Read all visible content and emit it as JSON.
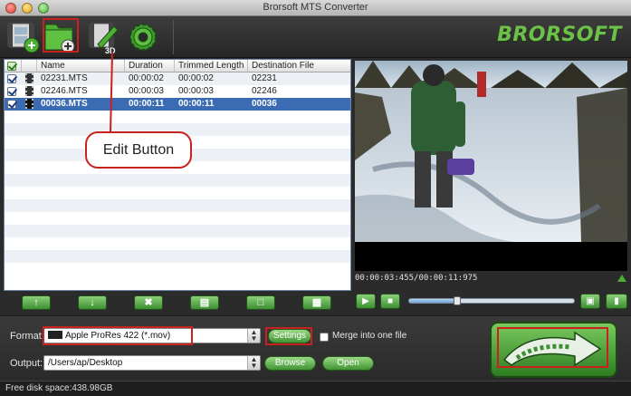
{
  "window": {
    "title": "Brorsoft MTS Converter"
  },
  "toolbar": {
    "logo_text": "BRORSOFT",
    "buttons": [
      "add-video",
      "edit",
      "3d-edit",
      "settings"
    ]
  },
  "file_list": {
    "columns": {
      "name": "Name",
      "duration": "Duration",
      "trimmed": "Trimmed Length",
      "destination": "Destination File"
    },
    "rows": [
      {
        "name": "02231.MTS",
        "duration": "00:00:02",
        "trimmed": "00:00:02",
        "destination": "02231",
        "checked": true,
        "selected": false
      },
      {
        "name": "02246.MTS",
        "duration": "00:00:03",
        "trimmed": "00:00:03",
        "destination": "02246",
        "checked": true,
        "selected": false
      },
      {
        "name": "00036.MTS",
        "duration": "00:00:11",
        "trimmed": "00:00:11",
        "destination": "00036",
        "checked": true,
        "selected": true
      }
    ]
  },
  "annotation": {
    "callout_text": "Edit Button",
    "color": "#c8211e"
  },
  "preview": {
    "timecode": "00:00:03:455/00:00:11:975",
    "seek_fraction": 0.29
  },
  "output_panel": {
    "format_label": "Format:",
    "format_value": "Apple ProRes 422 (*.mov)",
    "settings_button": "Settings",
    "merge_label": "Merge into one file",
    "output_label": "Output:",
    "output_path": "/Users/ap/Desktop",
    "browse_button": "Browse",
    "open_button": "Open"
  },
  "status": {
    "free_space": "Free disk space:438.98GB"
  },
  "colors": {
    "accent_green": "#3c8f31",
    "selection_blue": "#3b6bb3",
    "annotation_red": "#c8211e"
  }
}
